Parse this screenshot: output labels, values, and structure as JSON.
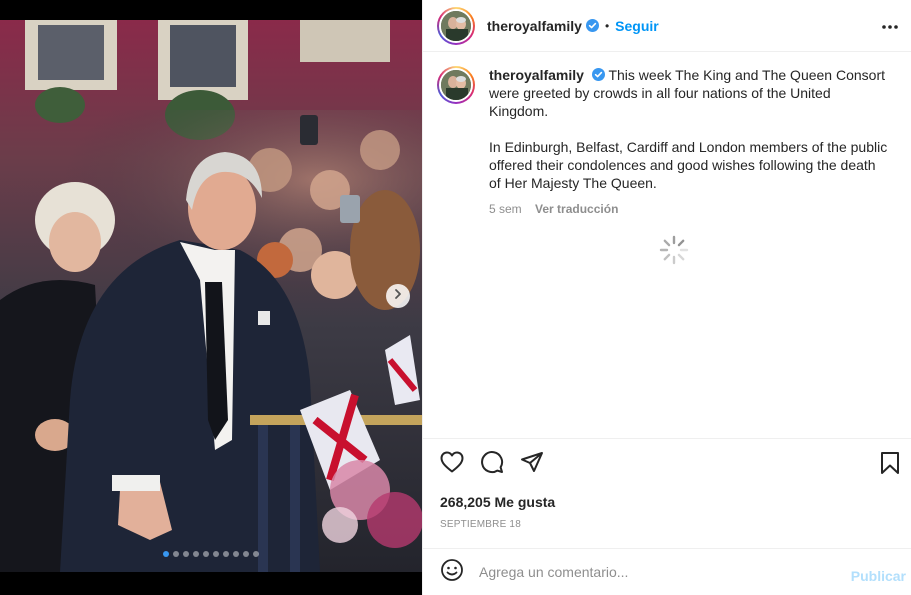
{
  "post": {
    "handle": "theroyalfamily",
    "separator": "•",
    "follow_label": "Seguir",
    "more_icon": "more-horizontal-icon",
    "verified_color": "#3897f0",
    "caption_p1": "This week The King and The Queen Consort were greeted by crowds in all four nations of the United Kingdom.",
    "caption_p2": "In Edinburgh, Belfast, Cardiff and London members of the public offered their condolences and good wishes following the death of Her Majesty The Queen.",
    "time_ago": "5 sem",
    "translate_label": "Ver traducción",
    "likes": "268,205 Me gusta",
    "date": "SEPTIEMBRE 18",
    "comment_placeholder": "Agrega un comentario...",
    "publish_label": "Publicar"
  },
  "carousel": {
    "slide_count": 10,
    "active_index": 0,
    "next_icon": "chevron-right-icon"
  },
  "colors": {
    "accent": "#0095f6",
    "publish_disabled": "#b2dffc",
    "muted_text": "#8e8e8e"
  }
}
